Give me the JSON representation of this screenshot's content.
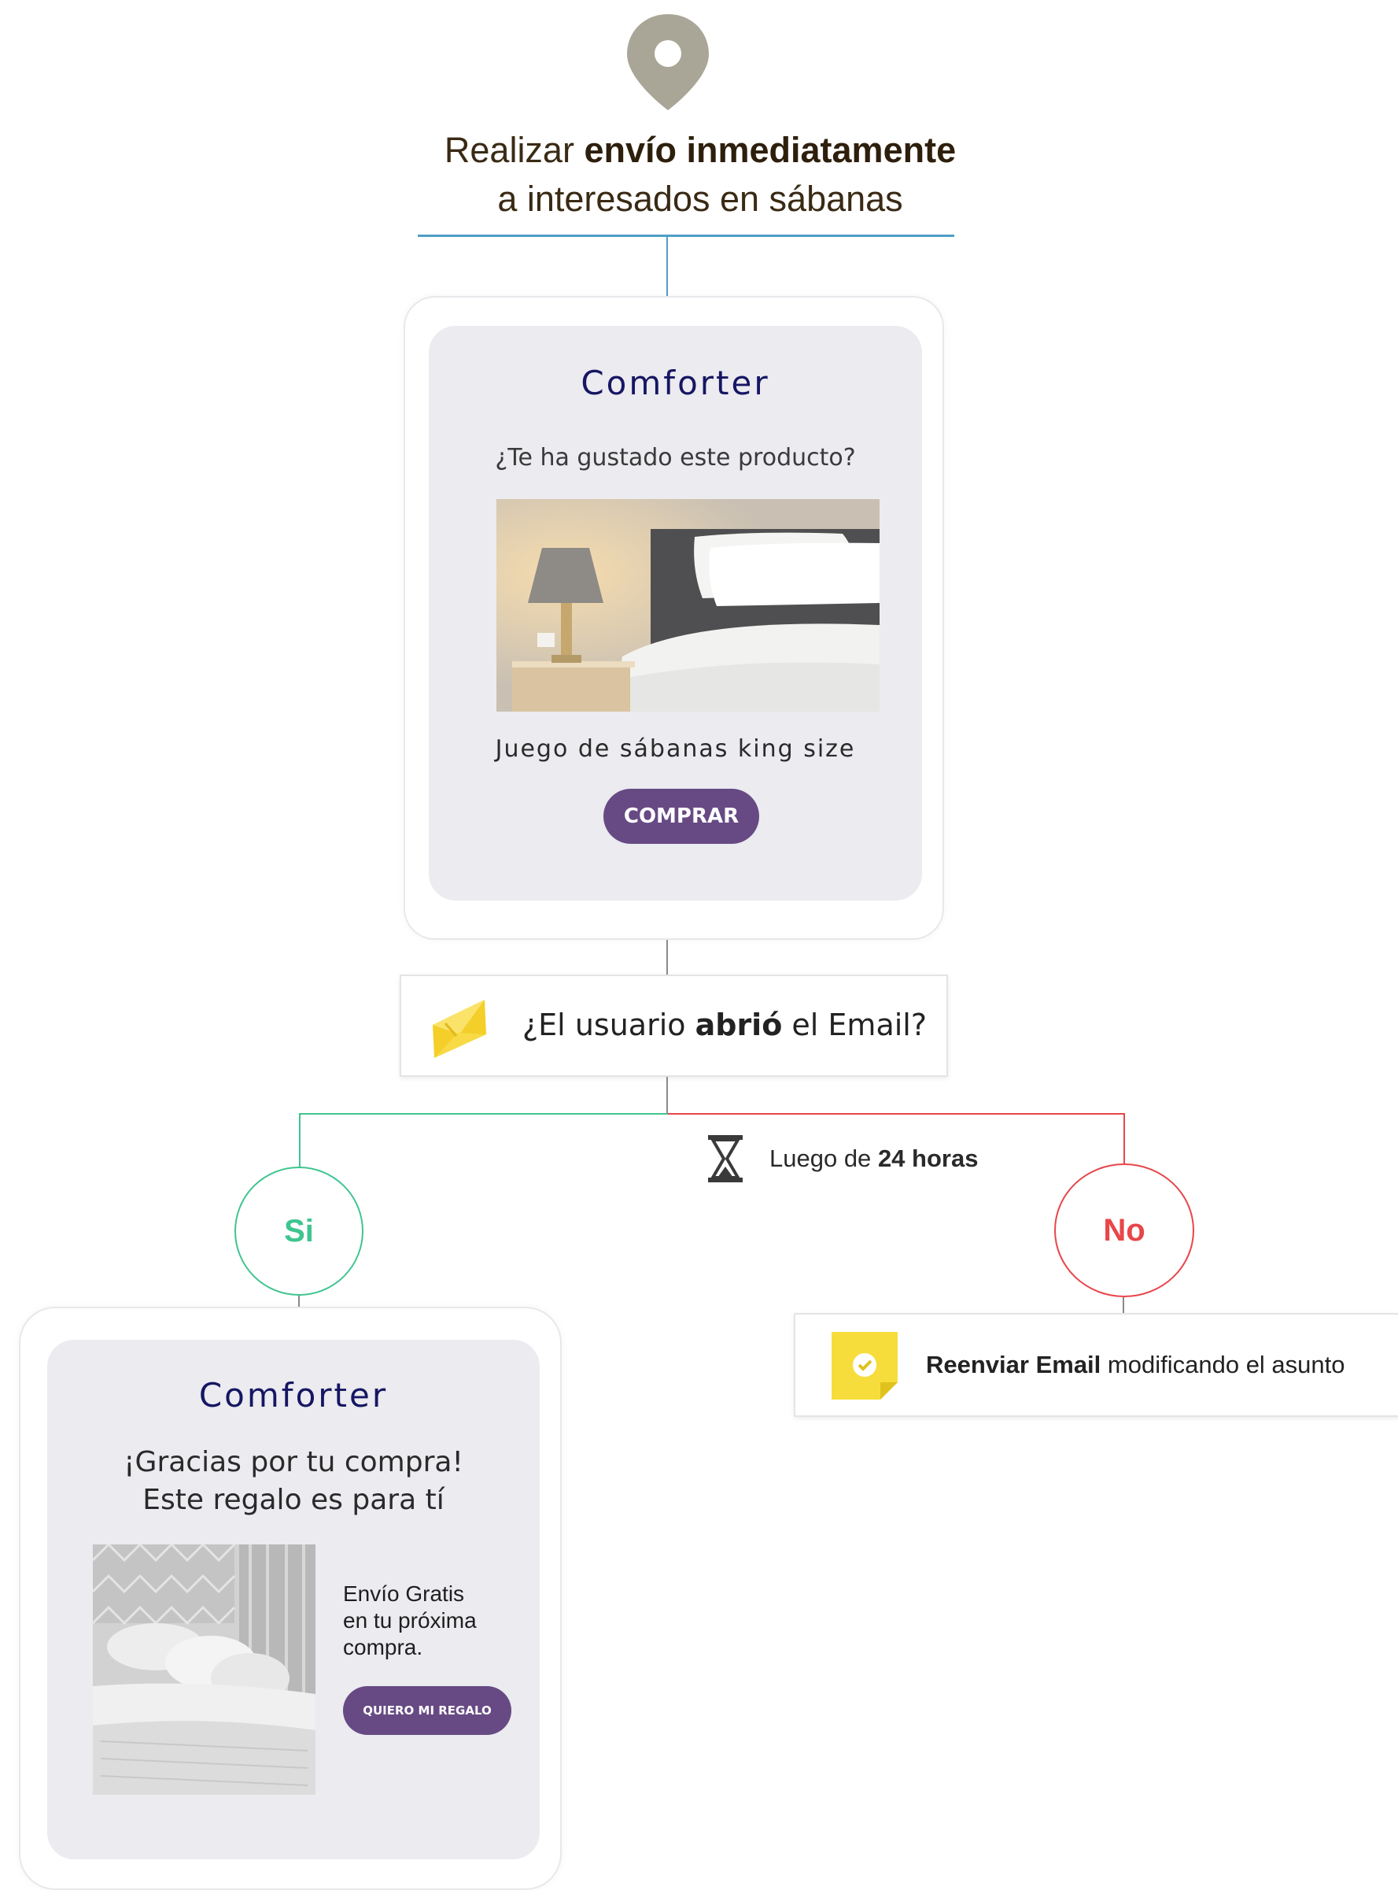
{
  "header": {
    "title_prefix": "Realizar",
    "title_bold": "envío inmediatamente",
    "title_line2": "a interesados en sábanas"
  },
  "email1": {
    "brand": "Comforter",
    "question": "¿Te ha gustado este producto?",
    "product_name": "Juego de sábanas king size",
    "button_label": "COMPRAR"
  },
  "decision": {
    "prefix": "¿El usuario",
    "bold": "abrió",
    "suffix": "el Email?"
  },
  "delay": {
    "prefix": "Luego de",
    "bold": "24 horas"
  },
  "branches": {
    "yes_label": "Si",
    "no_label": "No",
    "yes_color": "#3fc58f",
    "no_color": "#e8464a"
  },
  "email2": {
    "brand": "Comforter",
    "headline_line1": "¡Gracias por tu compra!",
    "headline_line2": "Este regalo es para tí",
    "offer_line1": "Envío Gratis",
    "offer_line2": "en tu próxima",
    "offer_line3": "compra.",
    "button_label": "QUIERO MI REGALO"
  },
  "resend": {
    "bold": "Reenviar Email",
    "suffix": "modificando el asunto"
  },
  "colors": {
    "accent_blue": "#4f9ec6",
    "button_purple": "#674a84",
    "brand_navy": "#161663",
    "card_gray": "#ebebf0"
  }
}
